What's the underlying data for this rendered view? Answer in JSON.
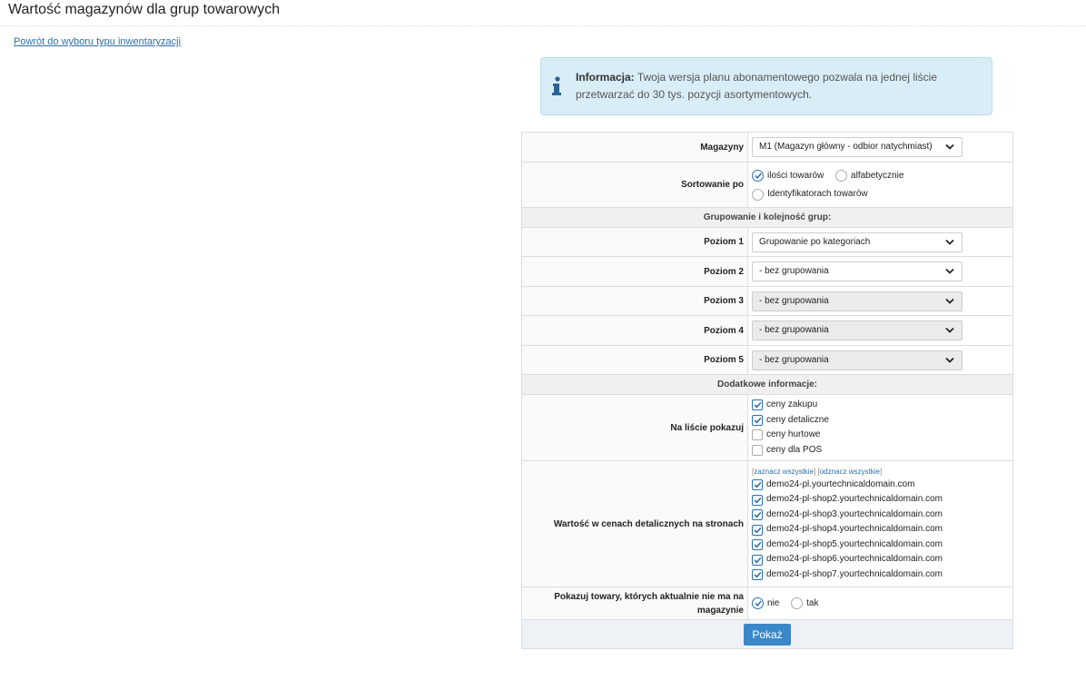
{
  "page": {
    "title": "Wartość magazynów dla grup towarowych",
    "back_link": "Powrót do wyboru typu inwentaryzacji"
  },
  "info": {
    "label": "Informacja:",
    "text": "Twoja wersja planu abonamentowego pozwala na jednej liście przetwarzać do 30 tys. pozycji asortymentowych."
  },
  "form": {
    "warehouses": {
      "label": "Magazyny",
      "value": "M1 (Magazyn główny - odbior natychmiast)"
    },
    "sort": {
      "label": "Sortowanie po",
      "options": [
        "ilości towarów",
        "alfabetycznie",
        "Identyfikatorach towarów"
      ],
      "selected": "ilości towarów"
    },
    "grouping": {
      "header": "Grupowanie i kolejność grup:",
      "levels": [
        {
          "label": "Poziom 1",
          "value": "Grupowanie po kategoriach"
        },
        {
          "label": "Poziom 2",
          "value": "- bez grupowania"
        },
        {
          "label": "Poziom 3",
          "value": "- bez grupowania"
        },
        {
          "label": "Poziom 4",
          "value": "- bez grupowania"
        },
        {
          "label": "Poziom 5",
          "value": "- bez grupowania"
        }
      ]
    },
    "additional": {
      "header": "Dodatkowe informacje:",
      "show_label": "Na liście pokazuj",
      "show_options": [
        {
          "label": "ceny zakupu",
          "checked": true
        },
        {
          "label": "ceny detaliczne",
          "checked": true
        },
        {
          "label": "ceny hurtowe",
          "checked": false
        },
        {
          "label": "ceny dla POS",
          "checked": false
        }
      ],
      "value_label": "Wartość w cenach detalicznych na stronach",
      "select_all": "zaznacz wszystkie",
      "deselect_all": "odznacz wszystkie",
      "sites": [
        {
          "label": "demo24-pl.yourtechnicaldomain.com",
          "checked": true
        },
        {
          "label": "demo24-pl-shop2.yourtechnicaldomain.com",
          "checked": true
        },
        {
          "label": "demo24-pl-shop3.yourtechnicaldomain.com",
          "checked": true
        },
        {
          "label": "demo24-pl-shop4.yourtechnicaldomain.com",
          "checked": true
        },
        {
          "label": "demo24-pl-shop5.yourtechnicaldomain.com",
          "checked": true
        },
        {
          "label": "demo24-pl-shop6.yourtechnicaldomain.com",
          "checked": true
        },
        {
          "label": "demo24-pl-shop7.yourtechnicaldomain.com",
          "checked": true
        }
      ],
      "out_of_stock": {
        "label": "Pokazuj towary, których aktualnie nie ma na magazynie",
        "options": [
          "nie",
          "tak"
        ],
        "selected": "nie"
      }
    },
    "submit": "Pokaż"
  },
  "colors": {
    "accent": "#3b88c8",
    "info_bg": "#d9edf7",
    "link": "#2d6ea7"
  }
}
